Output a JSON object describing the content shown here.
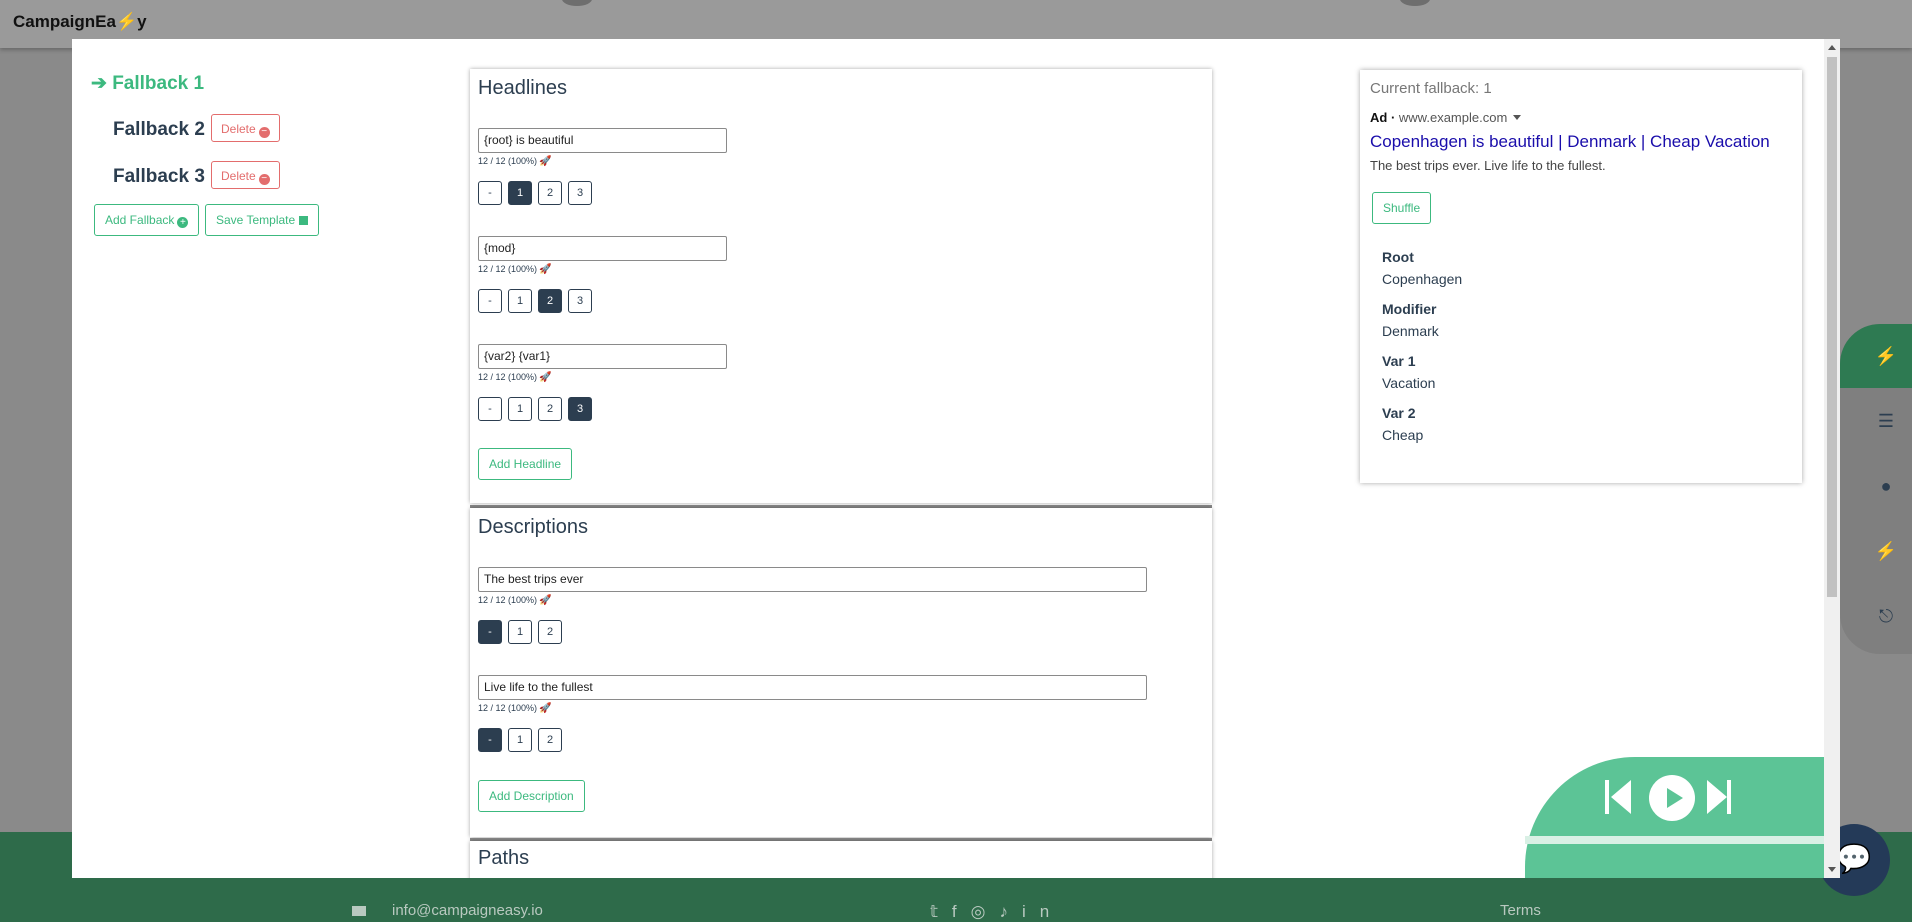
{
  "app": {
    "brand_prefix": "CampaignEa",
    "brand_bolt": "⚡",
    "brand_suffix": "y"
  },
  "fallbacks": {
    "items": [
      {
        "label": "Fallback 1",
        "active": true
      },
      {
        "label": "Fallback 2",
        "delete_label": "Delete"
      },
      {
        "label": "Fallback 3",
        "delete_label": "Delete"
      }
    ],
    "add_label": "Add Fallback",
    "save_label": "Save Template"
  },
  "headlines": {
    "title": "Headlines",
    "items": [
      {
        "value": "{root} is beautiful",
        "counter": "12 / 12 (100%)",
        "positions": [
          "-",
          "1",
          "2",
          "3"
        ],
        "selected": "1"
      },
      {
        "value": "{mod}",
        "counter": "12 / 12 (100%)",
        "positions": [
          "-",
          "1",
          "2",
          "3"
        ],
        "selected": "2"
      },
      {
        "value": "{var2} {var1}",
        "counter": "12 / 12 (100%)",
        "positions": [
          "-",
          "1",
          "2",
          "3"
        ],
        "selected": "3"
      }
    ],
    "add_label": "Add Headline"
  },
  "descriptions": {
    "title": "Descriptions",
    "items": [
      {
        "value": "The best trips ever",
        "counter": "12 / 12 (100%)",
        "positions": [
          "-",
          "1",
          "2"
        ],
        "selected": "-"
      },
      {
        "value": "Live life to the fullest",
        "counter": "12 / 12 (100%)",
        "positions": [
          "-",
          "1",
          "2"
        ],
        "selected": "-"
      }
    ],
    "add_label": "Add Description"
  },
  "paths": {
    "title": "Paths"
  },
  "preview": {
    "current": "Current fallback: 1",
    "ad_tag": "Ad ·",
    "url": "www.example.com",
    "title": "Copenhagen is beautiful | Denmark | Cheap Vacation",
    "description": "The best trips ever. Live life to the fullest.",
    "shuffle_label": "Shuffle",
    "values": [
      {
        "key": "Root",
        "value": "Copenhagen"
      },
      {
        "key": "Modifier",
        "value": "Denmark"
      },
      {
        "key": "Var 1",
        "value": "Vacation"
      },
      {
        "key": "Var 2",
        "value": "Cheap"
      }
    ]
  },
  "footer": {
    "email": "info@campaigneasy.io",
    "terms": "Terms"
  },
  "colors": {
    "accent": "#3cb97f",
    "danger": "#e36d6d",
    "dark": "#2c3e50",
    "link": "#1a0dab"
  }
}
